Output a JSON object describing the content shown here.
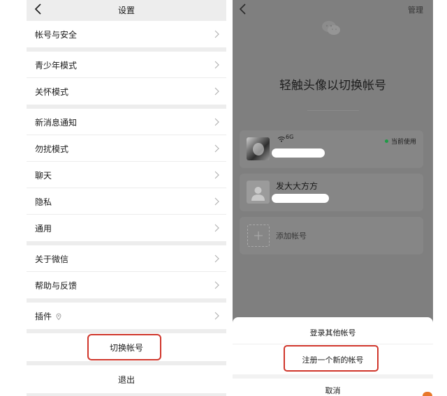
{
  "settings": {
    "title": "设置",
    "groups": [
      [
        {
          "label": "帐号与安全"
        }
      ],
      [
        {
          "label": "青少年模式"
        },
        {
          "label": "关怀模式"
        }
      ],
      [
        {
          "label": "新消息通知"
        },
        {
          "label": "勿扰模式"
        },
        {
          "label": "聊天"
        },
        {
          "label": "隐私"
        },
        {
          "label": "通用"
        }
      ],
      [
        {
          "label": "关于微信"
        },
        {
          "label": "帮助与反馈"
        }
      ],
      [
        {
          "label": "插件"
        }
      ]
    ],
    "switch_account": "切换帐号",
    "logout": "退出",
    "highlight_color": "#d0362b"
  },
  "switcher": {
    "manage": "管理",
    "headline": "轻触头像以切换帐号",
    "accounts": [
      {
        "network": "6G",
        "status": "当前使用"
      },
      {
        "name": "发大大方方"
      }
    ],
    "add_account": "添加帐号",
    "sheet": {
      "login_other": "登录其他帐号",
      "register": "注册一个新的帐号",
      "cancel": "取消"
    },
    "status_color": "#1f9b46"
  }
}
